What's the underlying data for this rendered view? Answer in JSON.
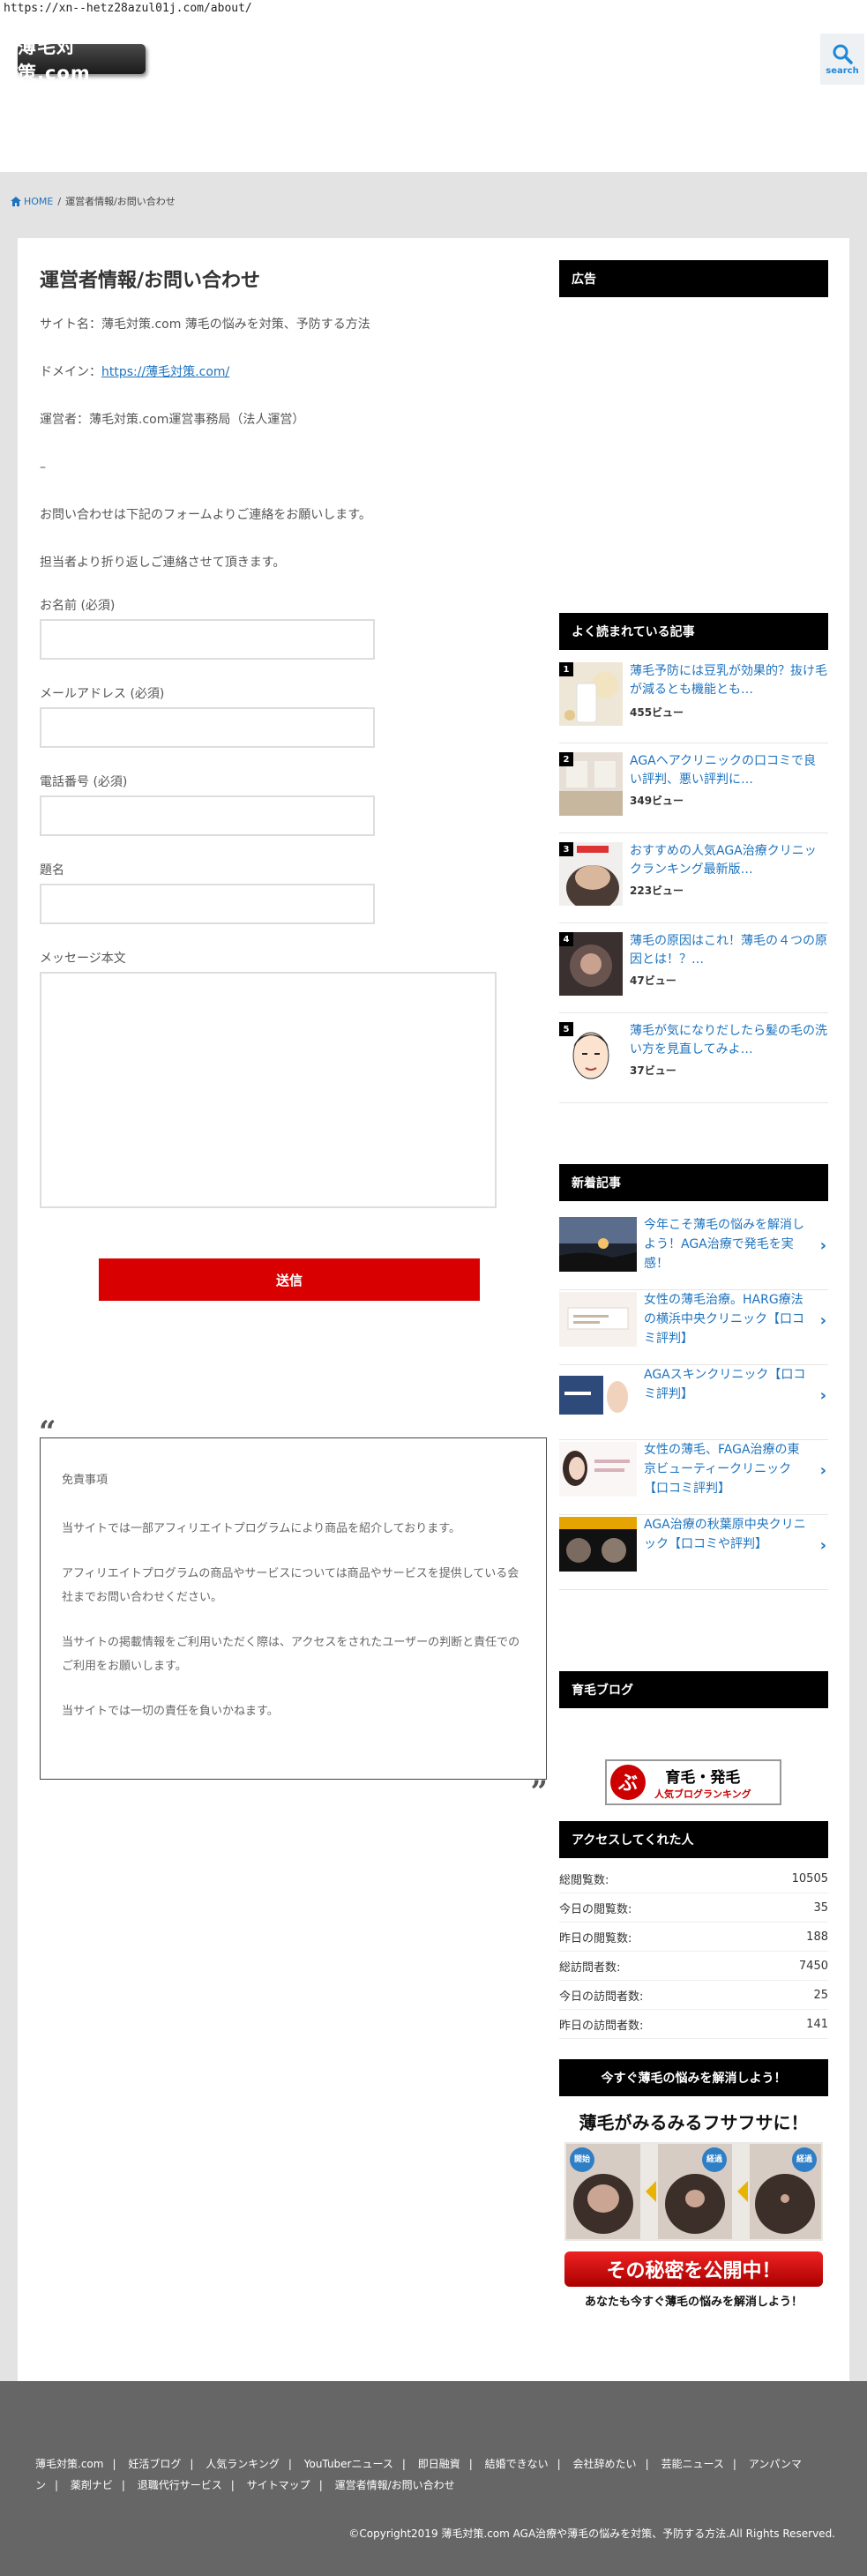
{
  "browser": {
    "url": "https://xn--hetz28azul01j.com/about/"
  },
  "header": {
    "logo_text": "薄毛対策.com",
    "search_label": "search"
  },
  "breadcrumb": {
    "home": "HOME",
    "sep": "/",
    "current": "運営者情報/お問い合わせ"
  },
  "content": {
    "title": "運営者情報/お問い合わせ",
    "site_name": "サイト名：薄毛対策.com 薄毛の悩みを対策、予防する方法",
    "domain_label": "ドメイン：",
    "domain_link": "https://薄毛対策.com/",
    "operator": "運営者：薄毛対策.com運営事務局（法人運営）",
    "dash": "–",
    "contact_note": "お問い合わせは下記のフォームよりご連絡をお願いします。",
    "reply_note": "担当者より折り返しご連絡させて頂きます。"
  },
  "form": {
    "name_label": "お名前 (必須)",
    "email_label": "メールアドレス (必須)",
    "phone_label": "電話番号 (必須)",
    "subject_label": "題名",
    "message_label": "メッセージ本文",
    "submit_label": "送信"
  },
  "disclaimer": {
    "title": "免責事項",
    "p1": "当サイトでは一部アフィリエイトプログラムにより商品を紹介しております。",
    "p2": "アフィリエイトプログラムの商品やサービスについては商品やサービスを提供している会社までお問い合わせください。",
    "p3": "当サイトの掲載情報をご利用いただく際は、アクセスをされたユーザーの判断と責任でのご利用をお願いします。",
    "p4": "当サイトでは一切の責任を負いかねます。"
  },
  "sidebar": {
    "ad_title": "広告",
    "popular_title": "よく読まれている記事",
    "popular": [
      {
        "rank": "1",
        "title": "薄毛予防には豆乳が効果的？抜け毛が減るとも機能とも…",
        "views": "455ビュー"
      },
      {
        "rank": "2",
        "title": "AGAヘアクリニックの口コミで良い評判、悪い評判に…",
        "views": "349ビュー"
      },
      {
        "rank": "3",
        "title": "おすすめの人気AGA治療クリニックランキング最新版…",
        "views": "223ビュー"
      },
      {
        "rank": "4",
        "title": "薄毛の原因はこれ！薄毛の４つの原因とは！？…",
        "views": "47ビュー"
      },
      {
        "rank": "5",
        "title": "薄毛が気になりだしたら髪の毛の洗い方を見直してみよ…",
        "views": "37ビュー"
      }
    ],
    "new_title": "新着記事",
    "new_articles": [
      {
        "title": "今年こそ薄毛の悩みを解消しよう！AGA治療で発毛を実感！"
      },
      {
        "title": "女性の薄毛治療。HARG療法の横浜中央クリニック【口コミ評判】"
      },
      {
        "title": "AGAスキンクリニック【口コミ評判】"
      },
      {
        "title": "女性の薄毛、FAGA治療の東京ビューティークリニック【口コミ評判】"
      },
      {
        "title": "AGA治療の秋葉原中央クリニック【口コミや評判】"
      }
    ],
    "blog_title": "育毛ブログ",
    "blog_banner_main": "育毛・発毛",
    "blog_banner_sub": "人気ブログランキング",
    "access_title": "アクセスしてくれた人",
    "stats": [
      {
        "label": "総閲覧数:",
        "value": "10505"
      },
      {
        "label": "今日の閲覧数:",
        "value": "35"
      },
      {
        "label": "昨日の閲覧数:",
        "value": "188"
      },
      {
        "label": "総訪問者数:",
        "value": "7450"
      },
      {
        "label": "今日の訪問者数:",
        "value": "25"
      },
      {
        "label": "昨日の訪問者数:",
        "value": "141"
      }
    ],
    "solve_title": "今すぐ薄毛の悩みを解消しよう！",
    "ad_banner": {
      "headline": "薄毛がみるみるフサフサに！",
      "step1": "開始",
      "step2": "経過",
      "step3": "経過",
      "cta": "その秘密を公開中！",
      "footer": "あなたも今すぐ薄毛の悩みを解消しよう！"
    }
  },
  "footer": {
    "links": [
      "薄毛対策.com",
      "妊活ブログ",
      "人気ランキング",
      "YouTuberニュース",
      "即日融資",
      "結婚できない",
      "会社辞めたい",
      "芸能ニュース",
      "アンパンマン",
      "薬剤ナビ",
      "退職代行サービス",
      "サイトマップ",
      "運営者情報/お問い合わせ"
    ],
    "separator": "|",
    "copyright": "©Copyright2019 薄毛対策.com AGA治療や薄毛の悩みを対策、予防する方法.All Rights Reserved."
  },
  "colors": {
    "accent": "#1e73be",
    "submit": "#d80000",
    "widget_bg": "#000000",
    "footer_bg": "#666666"
  }
}
